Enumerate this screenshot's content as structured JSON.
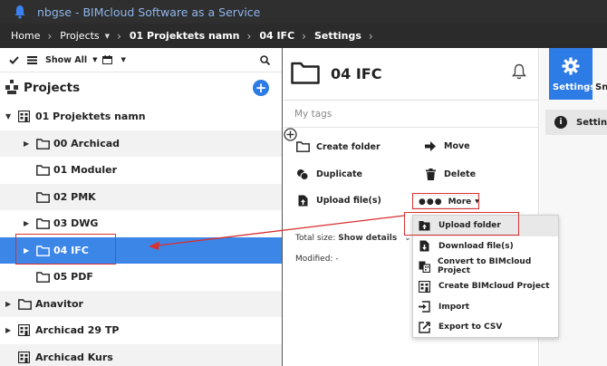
{
  "app": {
    "title": "nbgse - BIMcloud Software as a Service"
  },
  "breadcrumb": [
    {
      "label": "Home",
      "dropdown": false,
      "bold": false
    },
    {
      "label": "Projects",
      "dropdown": true,
      "bold": false
    },
    {
      "label": "01 Projektets namn",
      "dropdown": false,
      "bold": true
    },
    {
      "label": "04 IFC",
      "dropdown": false,
      "bold": true
    },
    {
      "label": "Settings",
      "dropdown": false,
      "bold": true
    }
  ],
  "toolbar": {
    "filter_label": "Show All"
  },
  "sidebar": {
    "title": "Projects",
    "items": [
      {
        "label": "01 Projektets namn",
        "level": 0,
        "expandable": true,
        "expanded": true,
        "icon": "building-icon"
      },
      {
        "label": "00 Archicad",
        "level": 1,
        "expandable": true,
        "expanded": false,
        "icon": "folder-icon"
      },
      {
        "label": "01 Moduler",
        "level": 1,
        "expandable": false,
        "expanded": false,
        "icon": "folder-icon"
      },
      {
        "label": "02 PMK",
        "level": 1,
        "expandable": false,
        "expanded": false,
        "icon": "folder-icon"
      },
      {
        "label": "03 DWG",
        "level": 1,
        "expandable": true,
        "expanded": false,
        "icon": "folder-icon"
      },
      {
        "label": "04 IFC",
        "level": 1,
        "expandable": true,
        "expanded": false,
        "icon": "folder-icon",
        "selected": true
      },
      {
        "label": "05 PDF",
        "level": 1,
        "expandable": false,
        "expanded": false,
        "icon": "folder-icon"
      },
      {
        "label": "Anavitor",
        "level": 0,
        "expandable": true,
        "expanded": false,
        "icon": "folder-icon"
      },
      {
        "label": "Archicad 29 TP",
        "level": 0,
        "expandable": true,
        "expanded": false,
        "icon": "building-icon"
      },
      {
        "label": "Archicad Kurs",
        "level": 0,
        "expandable": false,
        "expanded": false,
        "icon": "building-icon"
      }
    ]
  },
  "main": {
    "title": "04 IFC",
    "tags_placeholder": "My tags",
    "actions": {
      "create_folder": "Create folder",
      "move": "Move",
      "duplicate": "Duplicate",
      "delete": "Delete",
      "upload_files": "Upload file(s)",
      "more": "More"
    },
    "total_size_label": "Total size:",
    "show_details": "Show details",
    "modified_label": "Modified:",
    "modified_value": "-"
  },
  "more_menu": {
    "items": [
      {
        "label": "Upload folder",
        "icon": "upload-folder-icon",
        "highlighted": true
      },
      {
        "label": "Download file(s)",
        "icon": "download-icon",
        "highlighted": false
      },
      {
        "label": "Convert to BIMcloud Project",
        "icon": "convert-icon",
        "highlighted": false
      },
      {
        "label": "Create BIMcloud Project",
        "icon": "building-icon",
        "highlighted": false
      },
      {
        "label": "Import",
        "icon": "import-icon",
        "highlighted": false
      },
      {
        "label": "Export to CSV",
        "icon": "export-icon",
        "highlighted": false
      }
    ]
  },
  "right_panel": {
    "settings_tab": "Settings",
    "next_tab_partial": "Sn",
    "setting_row": "Setting"
  },
  "colors": {
    "accent": "#2d7be5",
    "selected_row": "#3c86e8",
    "annotation": "#d93030",
    "titlebar": "#2f2f2f"
  }
}
